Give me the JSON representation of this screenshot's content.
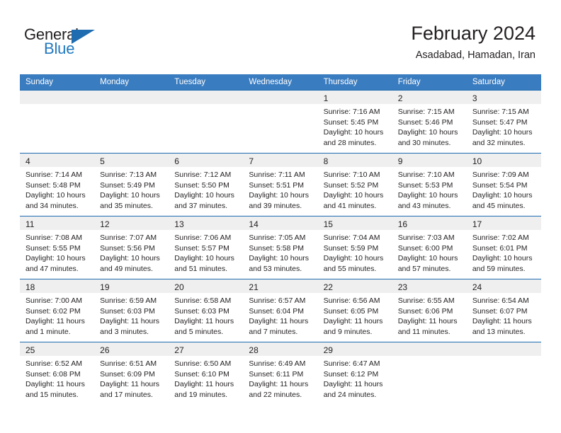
{
  "brand": {
    "name_part1": "General",
    "name_part2": "Blue",
    "flag_icon": "blue-flag-triangle",
    "accent_color": "#1f6cb0"
  },
  "header": {
    "title": "February 2024",
    "subtitle": "Asadabad, Hamadan, Iran"
  },
  "calendar": {
    "header_bg": "#3a7cc0",
    "row_border_color": "#1f6cb0",
    "daynum_band_bg": "#efefef",
    "weekdays": [
      "Sunday",
      "Monday",
      "Tuesday",
      "Wednesday",
      "Thursday",
      "Friday",
      "Saturday"
    ],
    "weeks": [
      [
        {
          "day": "",
          "sunrise": "",
          "sunset": "",
          "daylight1": "",
          "daylight2": ""
        },
        {
          "day": "",
          "sunrise": "",
          "sunset": "",
          "daylight1": "",
          "daylight2": ""
        },
        {
          "day": "",
          "sunrise": "",
          "sunset": "",
          "daylight1": "",
          "daylight2": ""
        },
        {
          "day": "",
          "sunrise": "",
          "sunset": "",
          "daylight1": "",
          "daylight2": ""
        },
        {
          "day": "1",
          "sunrise": "Sunrise: 7:16 AM",
          "sunset": "Sunset: 5:45 PM",
          "daylight1": "Daylight: 10 hours",
          "daylight2": "and 28 minutes."
        },
        {
          "day": "2",
          "sunrise": "Sunrise: 7:15 AM",
          "sunset": "Sunset: 5:46 PM",
          "daylight1": "Daylight: 10 hours",
          "daylight2": "and 30 minutes."
        },
        {
          "day": "3",
          "sunrise": "Sunrise: 7:15 AM",
          "sunset": "Sunset: 5:47 PM",
          "daylight1": "Daylight: 10 hours",
          "daylight2": "and 32 minutes."
        }
      ],
      [
        {
          "day": "4",
          "sunrise": "Sunrise: 7:14 AM",
          "sunset": "Sunset: 5:48 PM",
          "daylight1": "Daylight: 10 hours",
          "daylight2": "and 34 minutes."
        },
        {
          "day": "5",
          "sunrise": "Sunrise: 7:13 AM",
          "sunset": "Sunset: 5:49 PM",
          "daylight1": "Daylight: 10 hours",
          "daylight2": "and 35 minutes."
        },
        {
          "day": "6",
          "sunrise": "Sunrise: 7:12 AM",
          "sunset": "Sunset: 5:50 PM",
          "daylight1": "Daylight: 10 hours",
          "daylight2": "and 37 minutes."
        },
        {
          "day": "7",
          "sunrise": "Sunrise: 7:11 AM",
          "sunset": "Sunset: 5:51 PM",
          "daylight1": "Daylight: 10 hours",
          "daylight2": "and 39 minutes."
        },
        {
          "day": "8",
          "sunrise": "Sunrise: 7:10 AM",
          "sunset": "Sunset: 5:52 PM",
          "daylight1": "Daylight: 10 hours",
          "daylight2": "and 41 minutes."
        },
        {
          "day": "9",
          "sunrise": "Sunrise: 7:10 AM",
          "sunset": "Sunset: 5:53 PM",
          "daylight1": "Daylight: 10 hours",
          "daylight2": "and 43 minutes."
        },
        {
          "day": "10",
          "sunrise": "Sunrise: 7:09 AM",
          "sunset": "Sunset: 5:54 PM",
          "daylight1": "Daylight: 10 hours",
          "daylight2": "and 45 minutes."
        }
      ],
      [
        {
          "day": "11",
          "sunrise": "Sunrise: 7:08 AM",
          "sunset": "Sunset: 5:55 PM",
          "daylight1": "Daylight: 10 hours",
          "daylight2": "and 47 minutes."
        },
        {
          "day": "12",
          "sunrise": "Sunrise: 7:07 AM",
          "sunset": "Sunset: 5:56 PM",
          "daylight1": "Daylight: 10 hours",
          "daylight2": "and 49 minutes."
        },
        {
          "day": "13",
          "sunrise": "Sunrise: 7:06 AM",
          "sunset": "Sunset: 5:57 PM",
          "daylight1": "Daylight: 10 hours",
          "daylight2": "and 51 minutes."
        },
        {
          "day": "14",
          "sunrise": "Sunrise: 7:05 AM",
          "sunset": "Sunset: 5:58 PM",
          "daylight1": "Daylight: 10 hours",
          "daylight2": "and 53 minutes."
        },
        {
          "day": "15",
          "sunrise": "Sunrise: 7:04 AM",
          "sunset": "Sunset: 5:59 PM",
          "daylight1": "Daylight: 10 hours",
          "daylight2": "and 55 minutes."
        },
        {
          "day": "16",
          "sunrise": "Sunrise: 7:03 AM",
          "sunset": "Sunset: 6:00 PM",
          "daylight1": "Daylight: 10 hours",
          "daylight2": "and 57 minutes."
        },
        {
          "day": "17",
          "sunrise": "Sunrise: 7:02 AM",
          "sunset": "Sunset: 6:01 PM",
          "daylight1": "Daylight: 10 hours",
          "daylight2": "and 59 minutes."
        }
      ],
      [
        {
          "day": "18",
          "sunrise": "Sunrise: 7:00 AM",
          "sunset": "Sunset: 6:02 PM",
          "daylight1": "Daylight: 11 hours",
          "daylight2": "and 1 minute."
        },
        {
          "day": "19",
          "sunrise": "Sunrise: 6:59 AM",
          "sunset": "Sunset: 6:03 PM",
          "daylight1": "Daylight: 11 hours",
          "daylight2": "and 3 minutes."
        },
        {
          "day": "20",
          "sunrise": "Sunrise: 6:58 AM",
          "sunset": "Sunset: 6:03 PM",
          "daylight1": "Daylight: 11 hours",
          "daylight2": "and 5 minutes."
        },
        {
          "day": "21",
          "sunrise": "Sunrise: 6:57 AM",
          "sunset": "Sunset: 6:04 PM",
          "daylight1": "Daylight: 11 hours",
          "daylight2": "and 7 minutes."
        },
        {
          "day": "22",
          "sunrise": "Sunrise: 6:56 AM",
          "sunset": "Sunset: 6:05 PM",
          "daylight1": "Daylight: 11 hours",
          "daylight2": "and 9 minutes."
        },
        {
          "day": "23",
          "sunrise": "Sunrise: 6:55 AM",
          "sunset": "Sunset: 6:06 PM",
          "daylight1": "Daylight: 11 hours",
          "daylight2": "and 11 minutes."
        },
        {
          "day": "24",
          "sunrise": "Sunrise: 6:54 AM",
          "sunset": "Sunset: 6:07 PM",
          "daylight1": "Daylight: 11 hours",
          "daylight2": "and 13 minutes."
        }
      ],
      [
        {
          "day": "25",
          "sunrise": "Sunrise: 6:52 AM",
          "sunset": "Sunset: 6:08 PM",
          "daylight1": "Daylight: 11 hours",
          "daylight2": "and 15 minutes."
        },
        {
          "day": "26",
          "sunrise": "Sunrise: 6:51 AM",
          "sunset": "Sunset: 6:09 PM",
          "daylight1": "Daylight: 11 hours",
          "daylight2": "and 17 minutes."
        },
        {
          "day": "27",
          "sunrise": "Sunrise: 6:50 AM",
          "sunset": "Sunset: 6:10 PM",
          "daylight1": "Daylight: 11 hours",
          "daylight2": "and 19 minutes."
        },
        {
          "day": "28",
          "sunrise": "Sunrise: 6:49 AM",
          "sunset": "Sunset: 6:11 PM",
          "daylight1": "Daylight: 11 hours",
          "daylight2": "and 22 minutes."
        },
        {
          "day": "29",
          "sunrise": "Sunrise: 6:47 AM",
          "sunset": "Sunset: 6:12 PM",
          "daylight1": "Daylight: 11 hours",
          "daylight2": "and 24 minutes."
        },
        {
          "day": "",
          "sunrise": "",
          "sunset": "",
          "daylight1": "",
          "daylight2": ""
        },
        {
          "day": "",
          "sunrise": "",
          "sunset": "",
          "daylight1": "",
          "daylight2": ""
        }
      ]
    ]
  }
}
